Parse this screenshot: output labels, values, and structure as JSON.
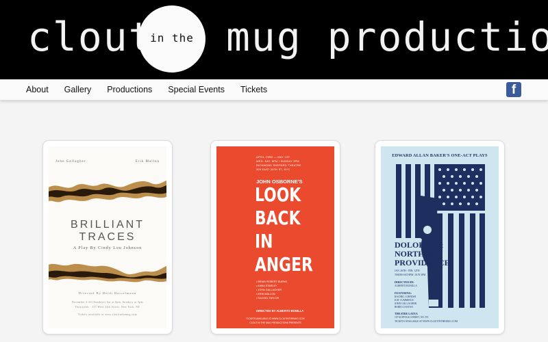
{
  "banner": {
    "word_1": "clout",
    "circle_text": "in the",
    "word_2": "mug productions"
  },
  "nav": {
    "items": [
      "About",
      "Gallery",
      "Productions",
      "Special Events",
      "Tickets"
    ],
    "facebook_glyph": "f",
    "facebook_icon": "facebook-icon",
    "facebook_color": "#3b5a9a"
  },
  "posters": [
    {
      "name_left": "John Gallagher",
      "name_right": "Erik Mallon",
      "title_line_1": "BRILLIANT",
      "title_line_2": "TRACES",
      "byline": "A Play By Cindy Lou Johnson",
      "directed": "Directed By Heidi Hasselmann",
      "fine_1": "December 4-20 (Sundays) Sat at 8pm, Sundays at 3pm",
      "fine_2": "Theatrelab · 357 West 34th Street, New York, NY",
      "fine_3": "Tickets available at www.cloutinthemug.com"
    },
    {
      "small_1": "APRIL 23RD — MAY 1ST",
      "small_2": "WED. SAT. 8PM / SUNDAY 3PM",
      "small_3": "RICHMOND SHEPARD THEATRE",
      "small_4": "309 EAST 26TH ST, NYC",
      "author": "JOHN OSBORNE'S",
      "big_1": "LOOK",
      "big_2": "BACK",
      "big_3": "IN",
      "big_4": "ANGER",
      "cast_1": "• BRIAN ROBERT BURNS",
      "cast_2": "• ANNA STARLEY",
      "cast_3": "• JOHN GALLAGHER",
      "cast_4": "• ERIK MALLON",
      "cast_5": "• RACHEL TAYLOR",
      "cast_6": "",
      "director": "DIRECTED BY ALBERTO BONILLA",
      "foot_1": "TICKETS AVAILABLE AT WWW.CLOUTINTHEMUG.COM",
      "foot_2": "CLOUT IN THE MUG PRODUCTIONS PRESENTS"
    },
    {
      "heading": "EDWARD ALLAN BAKER'S ONE-ACT PLAYS",
      "play_1": "DOLORES &",
      "play_2": "NORTH of",
      "play_3": "PROVIDENCE",
      "dates_1": "JAN. 26TH - FEB. 12TH",
      "dates_2": "THURS-SAT 8PM / SUN 3PM",
      "director_label": "DIRECTED BY:",
      "director_name": "ALBERTO BONILLA",
      "featuring_label": "FEATURING:",
      "featuring_1": "RACHEL CORNISH",
      "featuring_2": "KAT CUMMINGS",
      "featuring_3": "JOHN GALLAGHER",
      "featuring_4": "REBECCA RYAN",
      "venue_label": "THEATRE LATEA",
      "venue_1": "107 SUFFOLK STREET, NY, NY",
      "venue_2": "TICKETS AVAILABLE AT WWW.CLOUTINTHEMUG.COM",
      "colors": {
        "navy": "#1c2f5e",
        "sky": "#cfe6f1"
      }
    }
  ],
  "colors": {
    "banner_bg": "#000000",
    "banner_text": "#f2f2f2",
    "poster2_red": "#ea4a2e"
  }
}
